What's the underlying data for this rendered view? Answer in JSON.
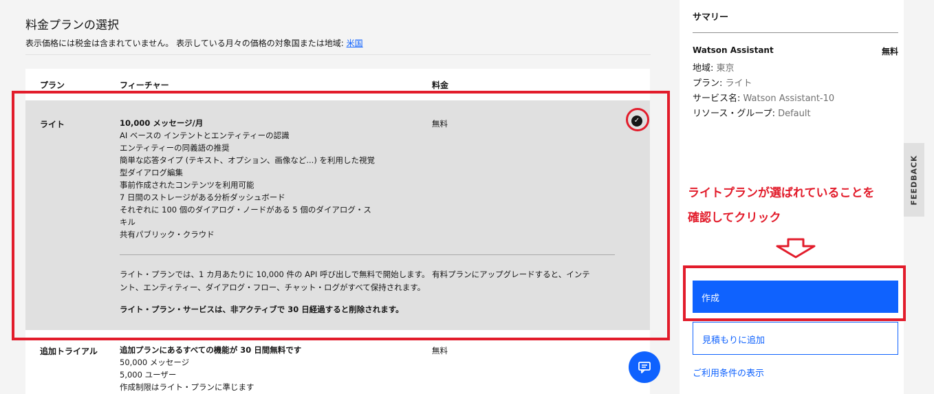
{
  "header": {
    "title": "料金プランの選択",
    "subtitle": "表示価格には税金は含まれていません。 表示している月々の価格の対象国または地域: ",
    "region_link": "米国"
  },
  "table": {
    "columns": [
      "プラン",
      "フィーチャー",
      "料金"
    ],
    "rows": [
      {
        "plan": "ライト",
        "feature_head": "10,000 メッセージ/月",
        "features": [
          "AI ベースの インテントとエンティティーの認識",
          "エンティティーの同義語の推奨",
          "簡単な応答タイプ (テキスト、オプション、画像など...) を利用した視覚",
          "型ダイアログ編集",
          "事前作成されたコンテンツを利用可能",
          "7 日間のストレージがある分析ダッシュボード",
          "それぞれに 100 個のダイアログ・ノードがある 5 個のダイアログ・ス",
          "キル",
          "共有パブリック・クラウド"
        ],
        "price": "無料",
        "note_line1": "ライト・プランでは、1 カ月あたりに 10,000 件の API 呼び出しで無料で開始します。 有料プランにアップグレードすると、インテ",
        "note_line2": "ント、エンティティー、ダイアログ・フロー、チャット・ログがすべて保持されます。",
        "note_bold": "ライト・プラン・サービスは、非アクティブで 30 日経過すると削除されます。",
        "selected": true
      },
      {
        "plan": "追加トライアル",
        "feature_head": "追加プランにあるすべての機能が 30 日間無料です",
        "features": [
          "50,000 メッセージ",
          "5,000 ユーザー",
          "作成制限はライト・プランに準じます"
        ],
        "price": "無料"
      }
    ]
  },
  "summary": {
    "title": "サマリー",
    "service": "Watson Assistant",
    "service_price": "無料",
    "region_label": "地域: ",
    "region_value": "東京",
    "plan_label": "プラン: ",
    "plan_value": "ライト",
    "service_name_label": "サービス名: ",
    "service_name_value": "Watson Assistant-10",
    "resource_group_label": "リソース・グループ: ",
    "resource_group_value": "Default",
    "create_label": "作成",
    "estimate_label": "見積もりに追加",
    "terms_label": "ご利用条件の表示"
  },
  "annotation": {
    "line1": "ライトプランが選ばれていることを",
    "line2": "確認してクリック",
    "color": "#e21c2b"
  },
  "feedback_label": "FEEDBACK",
  "colors": {
    "primary": "#0f62fe",
    "annotation": "#e21c2b",
    "selected_row": "#e0e0e0"
  }
}
